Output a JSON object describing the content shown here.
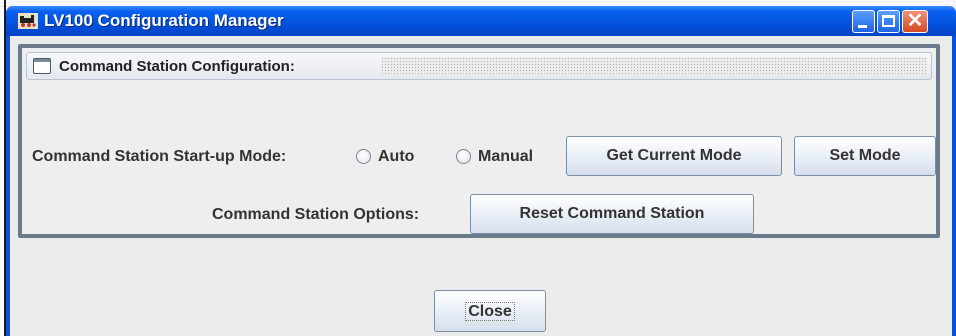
{
  "window": {
    "title": "LV100 Configuration Manager",
    "icon": "train-app-icon",
    "controls": {
      "minimize": "minimize-icon",
      "maximize": "maximize-icon",
      "close": "✕"
    }
  },
  "panel": {
    "title": "Command Station Configuration:",
    "icon": "internal-frame-icon"
  },
  "startup": {
    "label": "Command Station Start-up Mode:",
    "options": [
      {
        "label": "Auto",
        "selected": false
      },
      {
        "label": "Manual",
        "selected": false
      }
    ],
    "get_mode_label": "Get Current Mode",
    "set_mode_label": "Set Mode"
  },
  "options": {
    "label": "Command Station Options:",
    "reset_label": "Reset Command Station"
  },
  "footer": {
    "close_label": "Close"
  },
  "colors": {
    "titlebar": "#0553e0",
    "panel_border": "#6b7b8c",
    "client_bg": "#ebebeb"
  }
}
